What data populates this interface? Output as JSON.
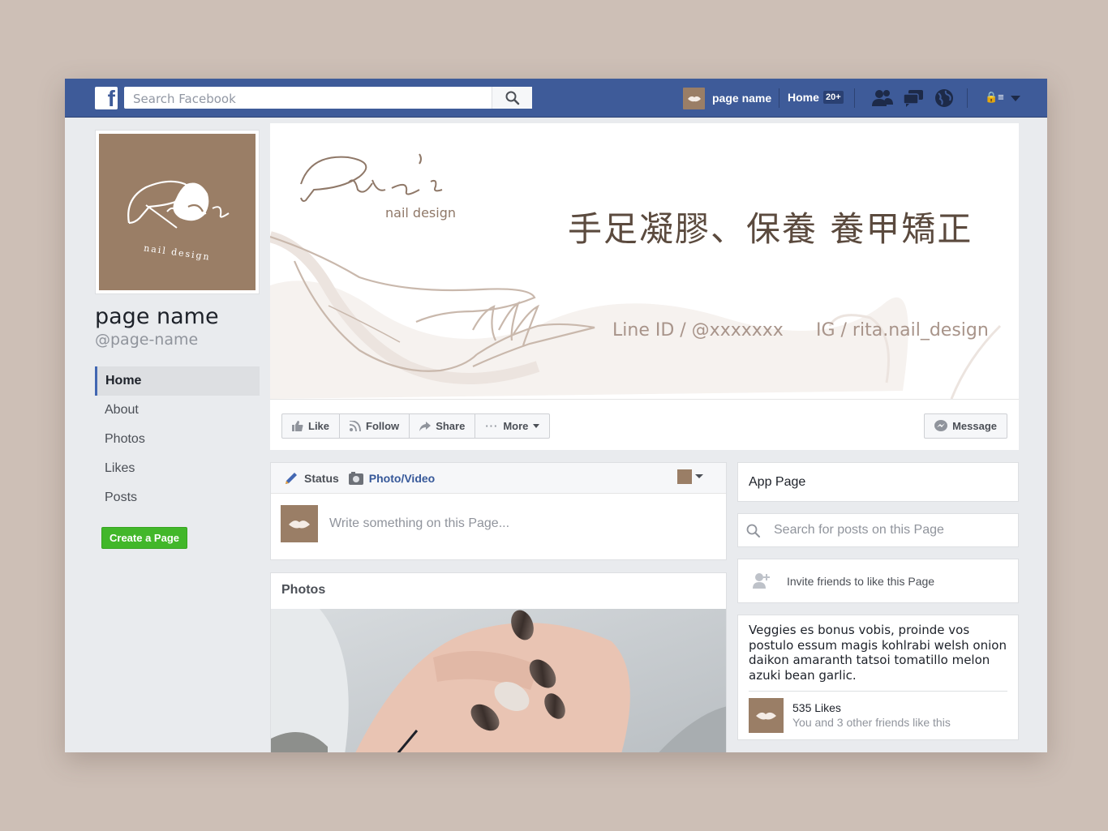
{
  "topbar": {
    "logo_letter": "f",
    "search_placeholder": "Search Facebook",
    "page_name": "page name",
    "home_label": "Home",
    "home_badge": "20+",
    "privacy_menu": "🔒≡"
  },
  "profile": {
    "name": "page name",
    "handle": "@page-name",
    "logo_text": "Rita",
    "logo_sub": "nail design"
  },
  "left_nav": {
    "items": [
      {
        "label": "Home",
        "active": true
      },
      {
        "label": "About"
      },
      {
        "label": "Photos"
      },
      {
        "label": "Likes"
      },
      {
        "label": "Posts"
      }
    ],
    "create_page": "Create a Page"
  },
  "cover": {
    "brand": "Rita's",
    "brand_sub": "nail design",
    "title": "手足凝膠、保養  養甲矯正",
    "line_id": "Line ID / @xxxxxxx",
    "ig": "IG / rita.nail_design"
  },
  "actions": {
    "like": "Like",
    "follow": "Follow",
    "share": "Share",
    "more": "More",
    "message": "Message"
  },
  "composer": {
    "status_tab": "Status",
    "photo_tab": "Photo/Video",
    "placeholder": "Write something on this Page..."
  },
  "photos": {
    "title": "Photos"
  },
  "sidebar": {
    "app_page": "App Page",
    "search_posts": "Search for posts on this Page",
    "invite": "Invite friends to like this Page",
    "about_text": "Veggies es bonus vobis, proinde vos postulo essum magis kohlrabi welsh onion daikon amaranth tatsoi tomatillo melon azuki bean garlic.",
    "likes": "535 Likes",
    "friends_like": "You and 3 other friends like this"
  },
  "colors": {
    "fb_blue": "#3e5b99",
    "brand_brown": "#9a7e66",
    "green": "#42b72a"
  }
}
